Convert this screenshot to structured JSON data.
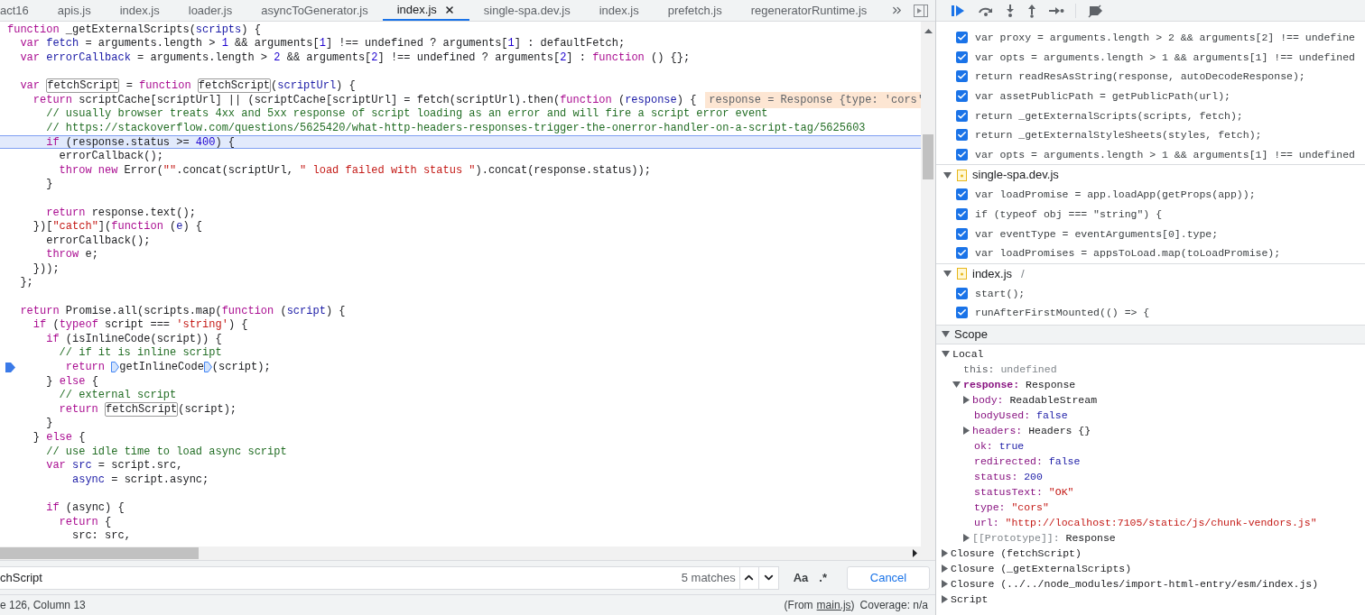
{
  "tabs": [
    {
      "label": "act16",
      "selected": false
    },
    {
      "label": "apis.js",
      "selected": false
    },
    {
      "label": "index.js",
      "selected": false
    },
    {
      "label": "loader.js",
      "selected": false
    },
    {
      "label": "asyncToGenerator.js",
      "selected": false
    },
    {
      "label": "index.js",
      "selected": true
    },
    {
      "label": "single-spa.dev.js",
      "selected": false
    },
    {
      "label": "index.js",
      "selected": false
    },
    {
      "label": "prefetch.js",
      "selected": false
    },
    {
      "label": "regeneratorRuntime.js",
      "selected": false
    }
  ],
  "editor": {
    "lines": [
      {
        "highlighted": false,
        "breakpoint": false,
        "tokens": [
          {
            "kind": "kw",
            "t": "function"
          },
          {
            "kind": "plain",
            "t": " _getExternalScripts("
          },
          {
            "kind": "def",
            "t": "scripts"
          },
          {
            "kind": "plain",
            "t": ") {"
          }
        ]
      },
      {
        "highlighted": false,
        "breakpoint": false,
        "tokens": [
          {
            "kind": "kw",
            "t": "  var"
          },
          {
            "kind": "def",
            "t": " fetch"
          },
          {
            "kind": "plain",
            "t": " = arguments.length > "
          },
          {
            "kind": "num",
            "t": "1"
          },
          {
            "kind": "plain",
            "t": " && arguments["
          },
          {
            "kind": "num",
            "t": "1"
          },
          {
            "kind": "plain",
            "t": "] !== undefined ? arguments["
          },
          {
            "kind": "num",
            "t": "1"
          },
          {
            "kind": "plain",
            "t": "] : defaultFetch;"
          }
        ]
      },
      {
        "highlighted": false,
        "breakpoint": false,
        "tokens": [
          {
            "kind": "kw",
            "t": "  var"
          },
          {
            "kind": "def",
            "t": " errorCallback"
          },
          {
            "kind": "plain",
            "t": " = arguments.length > "
          },
          {
            "kind": "num",
            "t": "2"
          },
          {
            "kind": "plain",
            "t": " && arguments["
          },
          {
            "kind": "num",
            "t": "2"
          },
          {
            "kind": "plain",
            "t": "] !== undefined ? arguments["
          },
          {
            "kind": "num",
            "t": "2"
          },
          {
            "kind": "plain",
            "t": "] : "
          },
          {
            "kind": "kw",
            "t": "function"
          },
          {
            "kind": "plain",
            "t": " () {};"
          }
        ]
      },
      {
        "highlighted": false,
        "breakpoint": false
      },
      {
        "highlighted": false,
        "breakpoint": false,
        "tokens": [
          {
            "kind": "kw",
            "t": "  var "
          },
          {
            "kind": "match",
            "t": "fetchScript"
          },
          {
            "kind": "plain",
            "t": " = "
          },
          {
            "kind": "kw",
            "t": "function "
          },
          {
            "kind": "match",
            "t": "fetchScript"
          },
          {
            "kind": "plain",
            "t": "("
          },
          {
            "kind": "def",
            "t": "scriptUrl"
          },
          {
            "kind": "plain",
            "t": ") {"
          }
        ]
      },
      {
        "highlighted": false,
        "breakpoint": false,
        "inline_value": "response = Response {type: 'cors'",
        "tokens": [
          {
            "kind": "kw",
            "t": "    return"
          },
          {
            "kind": "plain",
            "t": " scriptCache[scriptUrl] || (scriptCache[scriptUrl] = fetch(scriptUrl).then("
          },
          {
            "kind": "kw",
            "t": "function"
          },
          {
            "kind": "plain",
            "t": " ("
          },
          {
            "kind": "def",
            "t": "response"
          },
          {
            "kind": "plain",
            "t": ") {"
          }
        ]
      },
      {
        "highlighted": false,
        "breakpoint": false,
        "tokens": [
          {
            "kind": "cmt",
            "t": "      // usually browser treats 4xx and 5xx response of script loading as an error and will fire a script error event"
          }
        ]
      },
      {
        "highlighted": false,
        "breakpoint": false,
        "tokens": [
          {
            "kind": "cmt",
            "t": "      // https://stackoverflow.com/questions/5625420/what-http-headers-responses-trigger-the-onerror-handler-on-a-script-tag/5625603"
          }
        ]
      },
      {
        "highlighted": true,
        "breakpoint": false,
        "tokens": [
          {
            "kind": "kw",
            "t": "      if"
          },
          {
            "kind": "plain",
            "t": " (response.status >= "
          },
          {
            "kind": "num",
            "t": "400"
          },
          {
            "kind": "plain",
            "t": ") {"
          }
        ]
      },
      {
        "highlighted": false,
        "breakpoint": false,
        "tokens": [
          {
            "kind": "plain",
            "t": "        errorCallback();"
          }
        ]
      },
      {
        "highlighted": false,
        "breakpoint": false,
        "tokens": [
          {
            "kind": "kw",
            "t": "        throw new"
          },
          {
            "kind": "plain",
            "t": " Error("
          },
          {
            "kind": "str",
            "t": "\"\""
          },
          {
            "kind": "plain",
            "t": ".concat(scriptUrl, "
          },
          {
            "kind": "str",
            "t": "\" load failed with status \""
          },
          {
            "kind": "plain",
            "t": ").concat(response.status));"
          }
        ]
      },
      {
        "highlighted": false,
        "breakpoint": false,
        "tokens": [
          {
            "kind": "plain",
            "t": "      }"
          }
        ]
      },
      {
        "highlighted": false,
        "breakpoint": false
      },
      {
        "highlighted": false,
        "breakpoint": false,
        "tokens": [
          {
            "kind": "kw",
            "t": "      return"
          },
          {
            "kind": "plain",
            "t": " response.text();"
          }
        ]
      },
      {
        "highlighted": false,
        "breakpoint": false,
        "tokens": [
          {
            "kind": "plain",
            "t": "    })["
          },
          {
            "kind": "str",
            "t": "\"catch\""
          },
          {
            "kind": "plain",
            "t": "]("
          },
          {
            "kind": "kw",
            "t": "function"
          },
          {
            "kind": "plain",
            "t": " ("
          },
          {
            "kind": "def",
            "t": "e"
          },
          {
            "kind": "plain",
            "t": ") {"
          }
        ]
      },
      {
        "highlighted": false,
        "breakpoint": false,
        "tokens": [
          {
            "kind": "plain",
            "t": "      errorCallback();"
          }
        ]
      },
      {
        "highlighted": false,
        "breakpoint": false,
        "tokens": [
          {
            "kind": "kw",
            "t": "      throw"
          },
          {
            "kind": "plain",
            "t": " e;"
          }
        ]
      },
      {
        "highlighted": false,
        "breakpoint": false,
        "tokens": [
          {
            "kind": "plain",
            "t": "    }));"
          }
        ]
      },
      {
        "highlighted": false,
        "breakpoint": false,
        "tokens": [
          {
            "kind": "plain",
            "t": "  };"
          }
        ]
      },
      {
        "highlighted": false,
        "breakpoint": false
      },
      {
        "highlighted": false,
        "breakpoint": false,
        "tokens": [
          {
            "kind": "kw",
            "t": "  return"
          },
          {
            "kind": "plain",
            "t": " Promise.all(scripts.map("
          },
          {
            "kind": "kw",
            "t": "function"
          },
          {
            "kind": "plain",
            "t": " ("
          },
          {
            "kind": "def",
            "t": "script"
          },
          {
            "kind": "plain",
            "t": ") {"
          }
        ]
      },
      {
        "highlighted": false,
        "breakpoint": false,
        "tokens": [
          {
            "kind": "kw",
            "t": "    if"
          },
          {
            "kind": "plain",
            "t": " ("
          },
          {
            "kind": "kw",
            "t": "typeof"
          },
          {
            "kind": "plain",
            "t": " script === "
          },
          {
            "kind": "str",
            "t": "'string'"
          },
          {
            "kind": "plain",
            "t": ") {"
          }
        ]
      },
      {
        "highlighted": false,
        "breakpoint": false,
        "tokens": [
          {
            "kind": "kw",
            "t": "      if"
          },
          {
            "kind": "plain",
            "t": " (isInlineCode(script)) {"
          }
        ]
      },
      {
        "highlighted": false,
        "breakpoint": false,
        "tokens": [
          {
            "kind": "cmt",
            "t": "        // if it is inline script"
          }
        ]
      },
      {
        "highlighted": false,
        "breakpoint": true,
        "tokens": [
          {
            "kind": "kw",
            "t": "         return "
          },
          {
            "kind": "marker"
          },
          {
            "kind": "plain",
            "t": "getInlineCode"
          },
          {
            "kind": "marker"
          },
          {
            "kind": "plain",
            "t": "(script);"
          }
        ]
      },
      {
        "highlighted": false,
        "breakpoint": false,
        "tokens": [
          {
            "kind": "plain",
            "t": "      } "
          },
          {
            "kind": "kw",
            "t": "else"
          },
          {
            "kind": "plain",
            "t": " {"
          }
        ]
      },
      {
        "highlighted": false,
        "breakpoint": false,
        "tokens": [
          {
            "kind": "cmt",
            "t": "        // external script"
          }
        ]
      },
      {
        "highlighted": false,
        "breakpoint": false,
        "tokens": [
          {
            "kind": "kw",
            "t": "        return "
          },
          {
            "kind": "match",
            "t": "fetchScript"
          },
          {
            "kind": "plain",
            "t": "(script);"
          }
        ]
      },
      {
        "highlighted": false,
        "breakpoint": false,
        "tokens": [
          {
            "kind": "plain",
            "t": "      }"
          }
        ]
      },
      {
        "highlighted": false,
        "breakpoint": false,
        "tokens": [
          {
            "kind": "plain",
            "t": "    } "
          },
          {
            "kind": "kw",
            "t": "else"
          },
          {
            "kind": "plain",
            "t": " {"
          }
        ]
      },
      {
        "highlighted": false,
        "breakpoint": false,
        "tokens": [
          {
            "kind": "cmt",
            "t": "      // use idle time to load async script"
          }
        ]
      },
      {
        "highlighted": false,
        "breakpoint": false,
        "tokens": [
          {
            "kind": "kw",
            "t": "      var"
          },
          {
            "kind": "def",
            "t": " src"
          },
          {
            "kind": "plain",
            "t": " = script.src,"
          }
        ]
      },
      {
        "highlighted": false,
        "breakpoint": false,
        "tokens": [
          {
            "kind": "def",
            "t": "          async"
          },
          {
            "kind": "plain",
            "t": " = script.async;"
          }
        ]
      },
      {
        "highlighted": false,
        "breakpoint": false
      },
      {
        "highlighted": false,
        "breakpoint": false,
        "tokens": [
          {
            "kind": "kw",
            "t": "      if"
          },
          {
            "kind": "plain",
            "t": " (async) {"
          }
        ]
      },
      {
        "highlighted": false,
        "breakpoint": false,
        "tokens": [
          {
            "kind": "kw",
            "t": "        return"
          },
          {
            "kind": "plain",
            "t": " {"
          }
        ]
      },
      {
        "highlighted": false,
        "breakpoint": false,
        "tokens": [
          {
            "kind": "plain",
            "t": "          src: src,"
          }
        ]
      }
    ]
  },
  "search": {
    "value": "chScript",
    "match_count": "5 matches",
    "case_toggle": "Aa",
    "regex_toggle": ".*",
    "cancel": "Cancel"
  },
  "status_bar": {
    "position": "e 126, Column 13",
    "source_prefix": "(From",
    "source_link": "main.js",
    "source_suffix": ")",
    "coverage": "Coverage: n/a"
  },
  "breakpoints": [
    {
      "items": [
        {
          "code": "var proxy = arguments.length > 2 && arguments[2] !== undefine",
          "checked": true
        },
        {
          "code": "var opts = arguments.length > 1 && arguments[1] !== undefined",
          "checked": true
        },
        {
          "code": "return readResAsString(response, autoDecodeResponse);",
          "checked": true
        },
        {
          "code": "var assetPublicPath = getPublicPath(url);",
          "checked": true
        },
        {
          "code": "return _getExternalScripts(scripts, fetch);",
          "checked": true
        },
        {
          "code": "return _getExternalStyleSheets(styles, fetch);",
          "checked": true
        },
        {
          "code": "var opts = arguments.length > 1 && arguments[1] !== undefined",
          "checked": true
        }
      ]
    },
    {
      "file": "single-spa.dev.js",
      "expanded": true,
      "items": [
        {
          "code": "var loadPromise = app.loadApp(getProps(app));",
          "checked": true
        },
        {
          "code": "if (typeof obj === \"string\") {",
          "checked": true
        },
        {
          "code": "var eventType = eventArguments[0].type;",
          "checked": true
        },
        {
          "code": "var loadPromises = appsToLoad.map(toLoadPromise);",
          "checked": true
        }
      ]
    },
    {
      "file": "index.js",
      "path": "/",
      "expanded": true,
      "items": [
        {
          "code": "start();",
          "checked": true
        },
        {
          "code": "runAfterFirstMounted(() => {",
          "checked": true
        }
      ]
    }
  ],
  "scope": {
    "title": "Scope",
    "expanded": true,
    "tree": [
      {
        "kind": "scope",
        "label": "Local",
        "expanded": true,
        "children": [
          {
            "kind": "this",
            "key": "this:",
            "value": {
              "kind": "undefined",
              "text": "undefined"
            }
          },
          {
            "kind": "variable",
            "key": "response:",
            "value": {
              "kind": "object",
              "text": "Response"
            },
            "expanded": true,
            "children": [
              {
                "kind": "property",
                "key": "body:",
                "value": {
                  "kind": "object",
                  "text": "ReadableStream"
                },
                "expanded": false
              },
              {
                "kind": "property",
                "key": "bodyUsed:",
                "value": {
                  "kind": "literal",
                  "text": "false"
                }
              },
              {
                "kind": "property",
                "key": "headers:",
                "value": {
                  "kind": "object",
                  "text": "Headers {}"
                },
                "expanded": false
              },
              {
                "kind": "property",
                "key": "ok:",
                "value": {
                  "kind": "literal",
                  "text": "true"
                }
              },
              {
                "kind": "property",
                "key": "redirected:",
                "value": {
                  "kind": "literal",
                  "text": "false"
                }
              },
              {
                "kind": "property",
                "key": "status:",
                "value": {
                  "kind": "literal",
                  "text": "200"
                }
              },
              {
                "kind": "property",
                "key": "statusText:",
                "value": {
                  "kind": "string",
                  "text": "\"OK\""
                }
              },
              {
                "kind": "property",
                "key": "type:",
                "value": {
                  "kind": "string",
                  "text": "\"cors\""
                }
              },
              {
                "kind": "property",
                "key": "url:",
                "value": {
                  "kind": "string",
                  "text": "\"http://localhost:7105/static/js/chunk-vendors.js\""
                }
              },
              {
                "kind": "internal",
                "key": "[[Prototype]]:",
                "value": {
                  "kind": "object",
                  "text": "Response"
                },
                "expanded": false
              }
            ]
          }
        ]
      },
      {
        "kind": "scope",
        "label": "Closure (fetchScript)",
        "expanded": false
      },
      {
        "kind": "scope",
        "label": "Closure (_getExternalScripts)",
        "expanded": false
      },
      {
        "kind": "scope",
        "label": "Closure (../../node_modules/import-html-entry/esm/index.js)",
        "expanded": false
      },
      {
        "kind": "scope",
        "label": "Script",
        "expanded": false
      }
    ]
  }
}
